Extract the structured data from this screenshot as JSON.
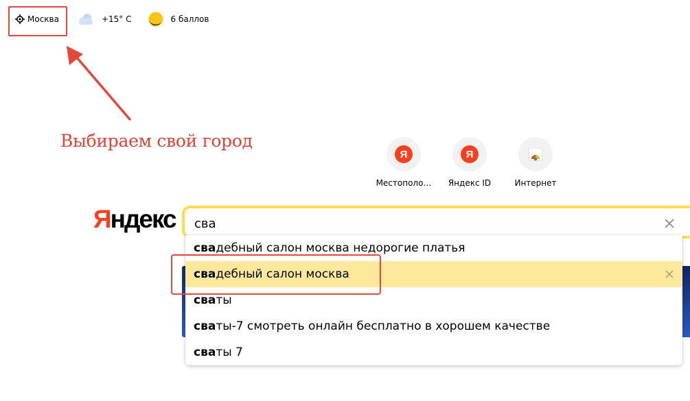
{
  "header": {
    "city": "Москва",
    "weather": "+15° С",
    "traffic": "6 баллов"
  },
  "tiles": [
    {
      "label": "Местополо…",
      "icon": "yandex-logo-icon",
      "badge": "Я"
    },
    {
      "label": "Яндекс ID",
      "icon": "yandex-logo-icon",
      "badge": "Я"
    },
    {
      "label": "Интернет",
      "icon": "chrome-icon"
    }
  ],
  "logo": {
    "first": "Я",
    "rest": "ндекс"
  },
  "search": {
    "query": "сва"
  },
  "suggestions": [
    {
      "bold": "сва",
      "rest": "дебный салон москва недорогие платья",
      "active": false
    },
    {
      "bold": "сва",
      "rest": "дебный салон москва",
      "active": true
    },
    {
      "bold": "сва",
      "rest": "ты",
      "active": false
    },
    {
      "bold": "сва",
      "rest": "ты-7 смотреть онлайн бесплатно в хорошем качестве",
      "active": false
    },
    {
      "bold": "сва",
      "rest": "ты 7",
      "active": false
    }
  ],
  "annotation": {
    "caption": "Выбираем свой город",
    "color": "#e2493a"
  },
  "colors": {
    "accent_yellow": "#ffdb4d",
    "yandex_red": "#fc3f1d",
    "highlight": "#fde99b"
  }
}
